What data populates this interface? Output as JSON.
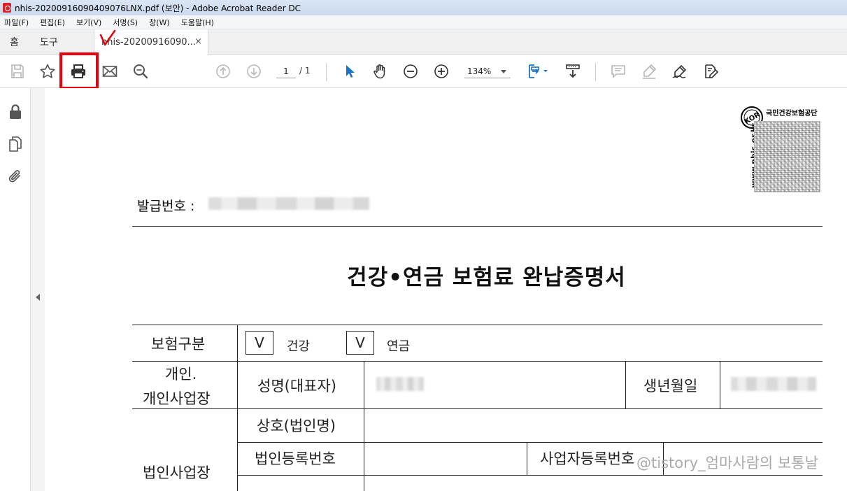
{
  "window": {
    "title": "nhis-20200916090409076LNX.pdf (보안) - Adobe Acrobat Reader DC"
  },
  "menu": [
    "파일(F)",
    "편집(E)",
    "보기(V)",
    "서명(S)",
    "창(W)",
    "도움말(H)"
  ],
  "tabs": {
    "home": "홈",
    "tools": "도구",
    "doc": "nhis-20200916090...",
    "close": "×"
  },
  "toolbar": {
    "page_current": "1",
    "page_total": "/ 1",
    "zoom": "134%"
  },
  "colors": {
    "highlight": "#e8000d",
    "accent": "#1a73c8"
  },
  "icons": [
    "save-icon",
    "star-icon",
    "print-icon",
    "email-icon",
    "search-zoom-icon",
    "prev-page-icon",
    "next-page-icon",
    "select-cursor-icon",
    "hand-tool-icon",
    "zoom-out-icon",
    "zoom-in-icon",
    "fit-page-icon",
    "scroll-mode-icon",
    "comment-icon",
    "highlight-pen-icon",
    "sign-icon",
    "edit-pdf-icon",
    "lock-icon",
    "pages-icon",
    "attachment-icon"
  ],
  "document": {
    "logo": {
      "org": "국민건강보험공단",
      "url": "www.nhis.or.kr",
      "seal": "KOR"
    },
    "issue_label": "발급번호 :",
    "title": "건강•연금 보험료 완납증명서",
    "insurance_type_label": "보험구분",
    "check1": "V",
    "health": "건강",
    "check2": "V",
    "pension": "연금",
    "individual_label_1": "개인.",
    "individual_label_2": "개인사업장",
    "name_label": "성명(대표자)",
    "birth_label": "생년월일",
    "corp_label": "법인사업장",
    "trade_name_label": "상호(법인명)",
    "corp_reg_label": "법인등록번호",
    "biz_reg_label": "사업자등록번호"
  },
  "watermark": "@tistory_엄마사람의 보통날"
}
